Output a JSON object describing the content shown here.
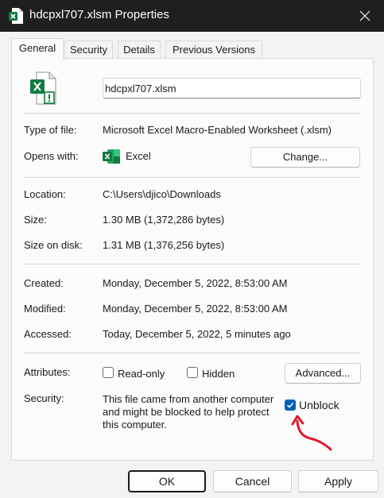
{
  "window": {
    "title": "hdcpxl707.xlsm Properties"
  },
  "tabs": [
    {
      "label": "General"
    },
    {
      "label": "Security"
    },
    {
      "label": "Details"
    },
    {
      "label": "Previous Versions"
    }
  ],
  "general": {
    "filename": "hdcpxl707.xlsm",
    "type_label": "Type of file:",
    "type_value": "Microsoft Excel Macro-Enabled Worksheet (.xlsm)",
    "opens_label": "Opens with:",
    "opens_value": "Excel",
    "change_button": "Change...",
    "location_label": "Location:",
    "location_value": "C:\\Users\\djico\\Downloads",
    "size_label": "Size:",
    "size_value": "1.30 MB (1,372,286 bytes)",
    "size_disk_label": "Size on disk:",
    "size_disk_value": "1.31 MB (1,376,256 bytes)",
    "created_label": "Created:",
    "created_value": "Monday, December 5, 2022, 8:53:00 AM",
    "modified_label": "Modified:",
    "modified_value": "Monday, December 5, 2022, 8:53:00 AM",
    "accessed_label": "Accessed:",
    "accessed_value": "Today, December 5, 2022, 5 minutes ago",
    "attributes_label": "Attributes:",
    "readonly_label": "Read-only",
    "readonly_checked": false,
    "hidden_label": "Hidden",
    "hidden_checked": false,
    "advanced_button": "Advanced...",
    "security_label": "Security:",
    "security_line1": "This file came from another computer",
    "security_line2": "and might be blocked to help protect",
    "security_line3": "this computer.",
    "unblock_label": "Unblock",
    "unblock_checked": true
  },
  "footer": {
    "ok": "OK",
    "cancel": "Cancel",
    "apply": "Apply"
  },
  "colors": {
    "titlebar": "#1f1f1f",
    "accent": "#005fb8",
    "excel_green": "#107c41",
    "annotation_red": "#e0192b"
  },
  "icons": {
    "app": "excel-file-icon",
    "close": "close-icon",
    "file": "excel-macro-file-icon",
    "opens_with": "excel-icon",
    "check": "checkmark-icon",
    "annotation": "red-arrow-annotation"
  }
}
